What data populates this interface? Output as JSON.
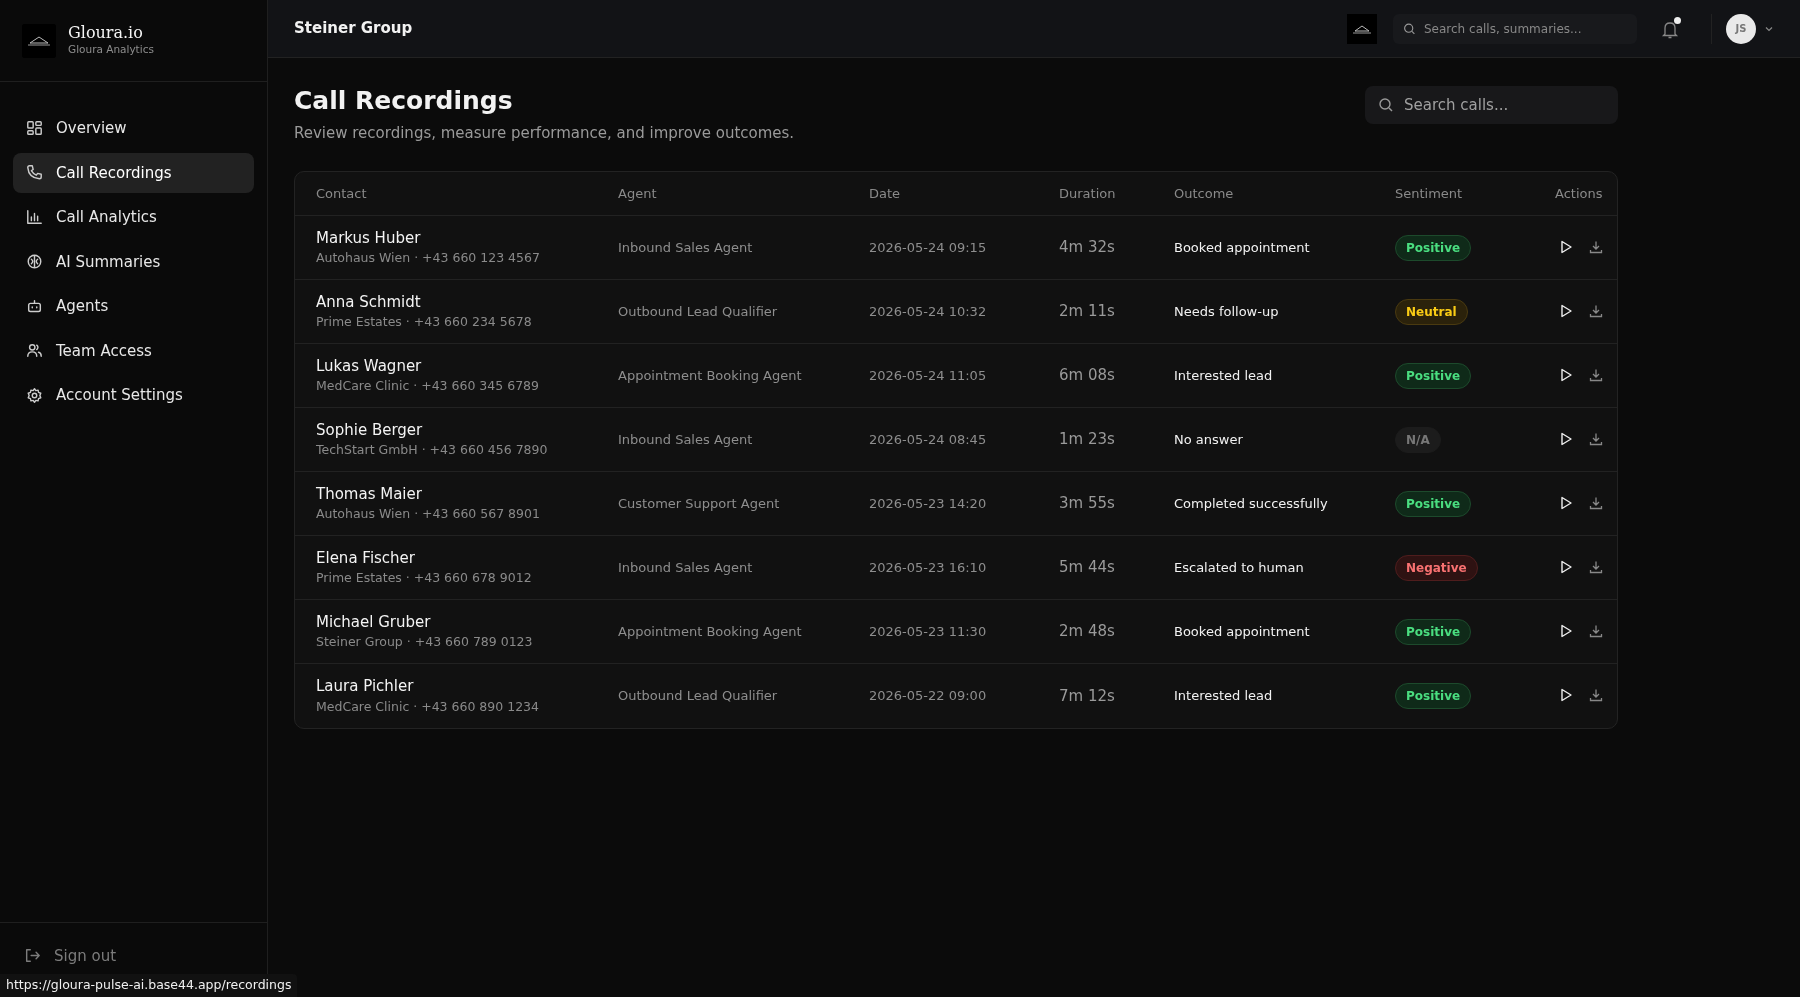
{
  "brand": {
    "name": "Gloura.io",
    "subtitle": "Gloura Analytics"
  },
  "sidebar": {
    "items": [
      {
        "label": "Overview",
        "selected": false
      },
      {
        "label": "Call Recordings",
        "selected": true
      },
      {
        "label": "Call Analytics",
        "selected": false
      },
      {
        "label": "AI Summaries",
        "selected": false
      },
      {
        "label": "Agents",
        "selected": false
      },
      {
        "label": "Team Access",
        "selected": false
      },
      {
        "label": "Account Settings",
        "selected": false
      }
    ],
    "sign_out": "Sign out"
  },
  "header": {
    "title": "Steiner Group",
    "search": {
      "placeholder": "Search calls, summaries..."
    },
    "notification_dot": true,
    "avatar_initials": "JS"
  },
  "page": {
    "title": "Call Recordings",
    "subtitle": "Review recordings, measure performance, and improve outcomes.",
    "search": {
      "placeholder": "Search calls..."
    }
  },
  "table": {
    "columns": [
      "Contact",
      "Agent",
      "Date",
      "Duration",
      "Outcome",
      "Sentiment",
      "Actions"
    ],
    "rows": [
      {
        "name": "Markus Huber",
        "details": "Autohaus Wien · +43 660 123 4567",
        "agent": "Inbound Sales Agent",
        "date": "2026-05-24 09:15",
        "duration": "4m 32s",
        "outcome": "Booked appointment",
        "sentiment": {
          "label": "Positive",
          "kind": "positive"
        }
      },
      {
        "name": "Anna Schmidt",
        "details": "Prime Estates · +43 660 234 5678",
        "agent": "Outbound Lead Qualifier",
        "date": "2026-05-24 10:32",
        "duration": "2m 11s",
        "outcome": "Needs follow-up",
        "sentiment": {
          "label": "Neutral",
          "kind": "neutral"
        }
      },
      {
        "name": "Lukas Wagner",
        "details": "MedCare Clinic · +43 660 345 6789",
        "agent": "Appointment Booking Agent",
        "date": "2026-05-24 11:05",
        "duration": "6m 08s",
        "outcome": "Interested lead",
        "sentiment": {
          "label": "Positive",
          "kind": "positive"
        }
      },
      {
        "name": "Sophie Berger",
        "details": "TechStart GmbH · +43 660 456 7890",
        "agent": "Inbound Sales Agent",
        "date": "2026-05-24 08:45",
        "duration": "1m 23s",
        "outcome": "No answer",
        "sentiment": {
          "label": "N/A",
          "kind": "none"
        }
      },
      {
        "name": "Thomas Maier",
        "details": "Autohaus Wien · +43 660 567 8901",
        "agent": "Customer Support Agent",
        "date": "2026-05-23 14:20",
        "duration": "3m 55s",
        "outcome": "Completed successfully",
        "sentiment": {
          "label": "Positive",
          "kind": "positive"
        }
      },
      {
        "name": "Elena Fischer",
        "details": "Prime Estates · +43 660 678 9012",
        "agent": "Inbound Sales Agent",
        "date": "2026-05-23 16:10",
        "duration": "5m 44s",
        "outcome": "Escalated to human",
        "sentiment": {
          "label": "Negative",
          "kind": "negative"
        }
      },
      {
        "name": "Michael Gruber",
        "details": "Steiner Group · +43 660 789 0123",
        "agent": "Appointment Booking Agent",
        "date": "2026-05-23 11:30",
        "duration": "2m 48s",
        "outcome": "Booked appointment",
        "sentiment": {
          "label": "Positive",
          "kind": "positive"
        }
      },
      {
        "name": "Laura Pichler",
        "details": "MedCare Clinic · +43 660 890 1234",
        "agent": "Outbound Lead Qualifier",
        "date": "2026-05-22 09:00",
        "duration": "7m 12s",
        "outcome": "Interested lead",
        "sentiment": {
          "label": "Positive",
          "kind": "positive"
        }
      }
    ]
  },
  "status_bar": {
    "url": "https://gloura-pulse-ai.base44.app/recordings"
  }
}
